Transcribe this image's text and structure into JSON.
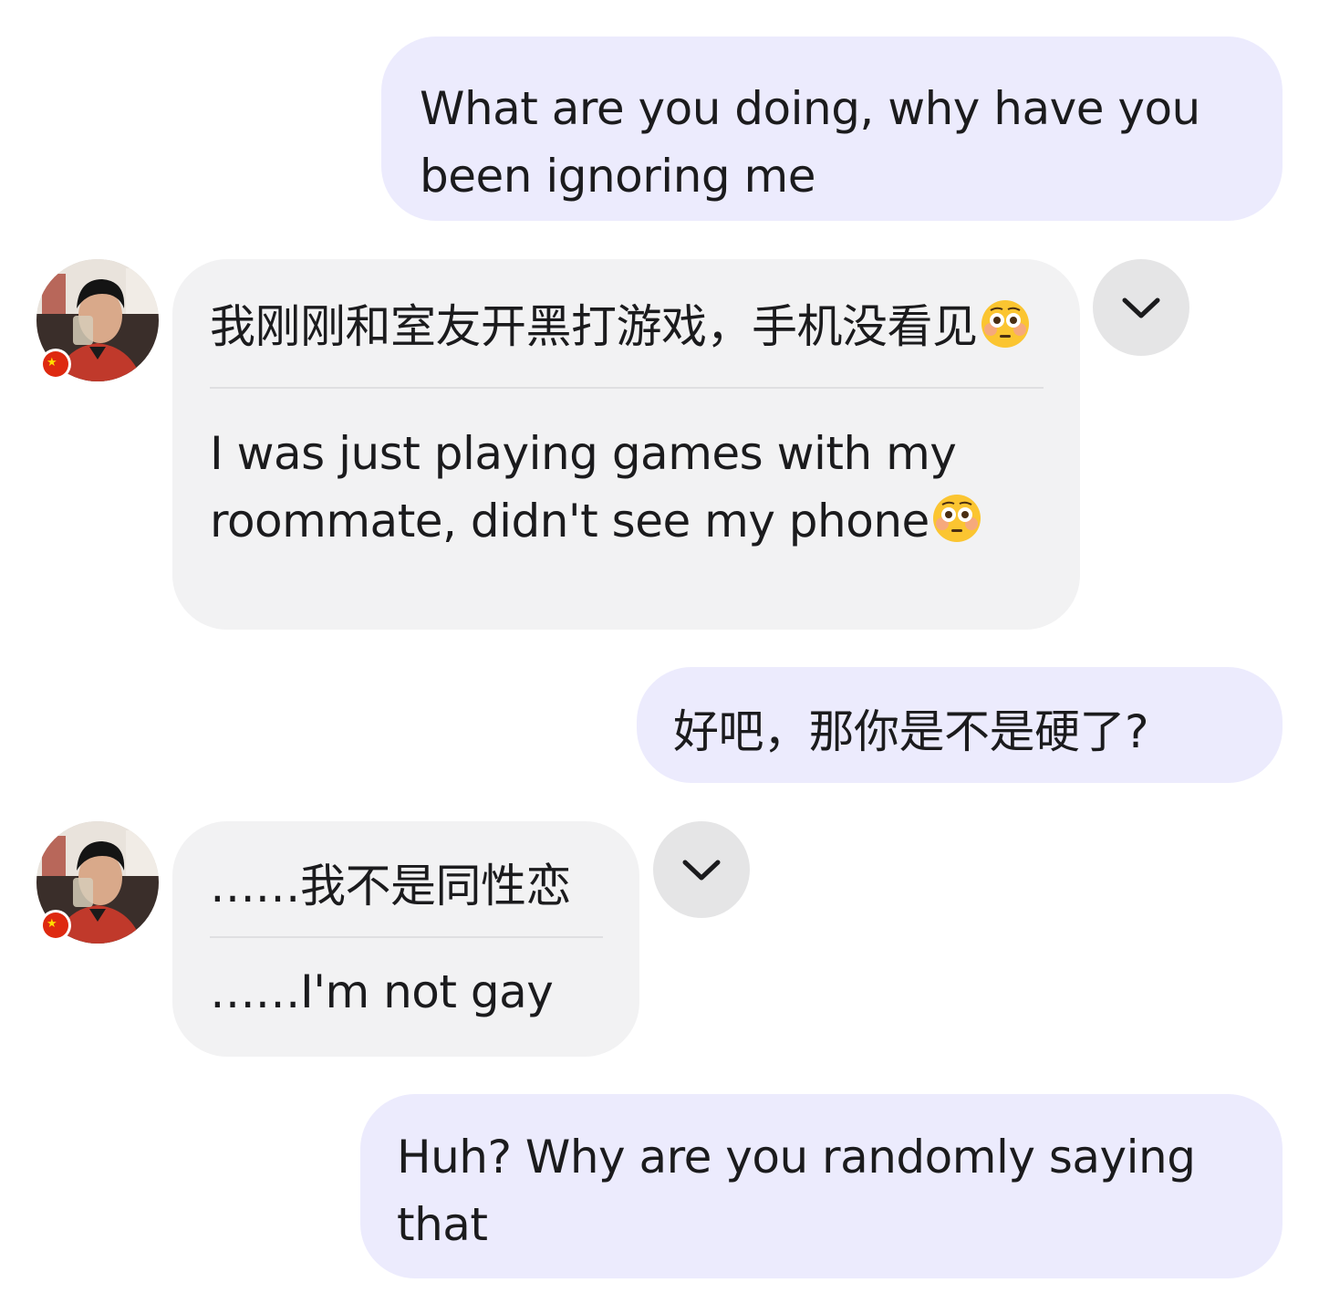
{
  "messages": [
    {
      "direction": "outgoing",
      "text": "What are you doing, why have you been ignoring me"
    },
    {
      "direction": "incoming",
      "original": "我刚刚和室友开黑打游戏，手机没看见",
      "translation": "I was just playing games with my roommate, didn't see my phone",
      "emoji": "flushed-face"
    },
    {
      "direction": "outgoing",
      "text": "好吧，那你是不是硬了?"
    },
    {
      "direction": "incoming",
      "original": "……我不是同性恋",
      "translation": "……I'm not gay"
    },
    {
      "direction": "outgoing",
      "text": "Huh? Why are you randomly saying that"
    }
  ],
  "sender": {
    "flag": "china-flag",
    "icons": {
      "avatar": "profile-photo",
      "expand": "chevron-down-icon"
    }
  },
  "colors": {
    "outgoing_bubble": "#ecebfd",
    "incoming_bubble": "#f2f2f3",
    "expand_button": "#e5e5e6",
    "flag_red": "#de2910"
  }
}
